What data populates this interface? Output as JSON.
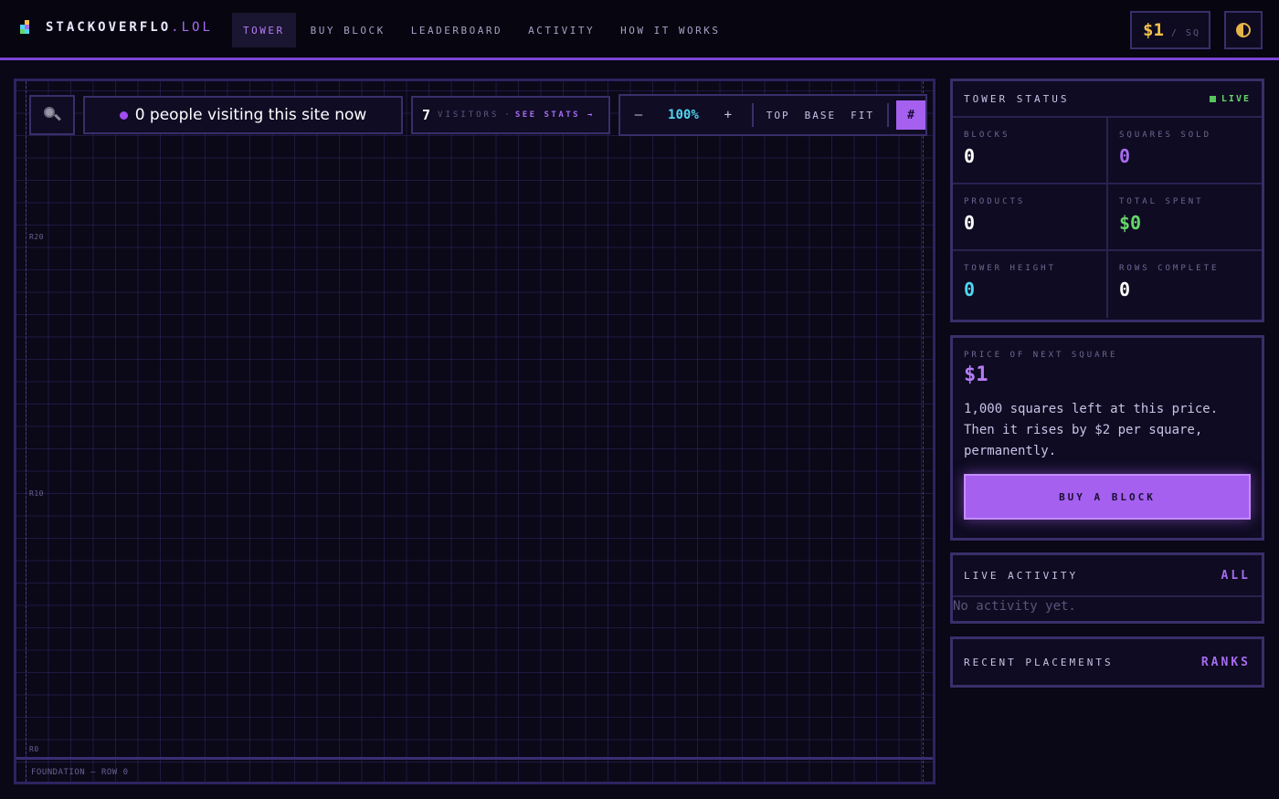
{
  "header": {
    "logo_main": "STACKOVERFLO",
    "logo_tld": ".LOL",
    "logo_colors": [
      "#f2c04a",
      "#4fd6f0",
      "#a66cf0",
      "#66d66a"
    ],
    "nav": [
      {
        "label": "TOWER",
        "active": true
      },
      {
        "label": "BUY BLOCK",
        "active": false
      },
      {
        "label": "LEADERBOARD",
        "active": false
      },
      {
        "label": "ACTIVITY",
        "active": false
      },
      {
        "label": "HOW IT WORKS",
        "active": false
      }
    ],
    "price": "$1",
    "price_unit": "/ SQ",
    "theme_icon": "half-circle-icon"
  },
  "tower": {
    "visiting_text": "0 people visiting this site now",
    "visitors_count": "7",
    "visitors_label": "VISITORS",
    "visitors_sep": "·",
    "see_stats": "SEE STATS →",
    "zoom_minus": "–",
    "zoom_level": "100%",
    "zoom_plus": "+",
    "top_label": "TOP",
    "base_label": "BASE",
    "fit_label": "FIT",
    "grid_label": "#",
    "row_labels": [
      "R20",
      "R10",
      "R0"
    ],
    "foundation_label": "FOUNDATION — ROW 0"
  },
  "status": {
    "title": "TOWER STATUS",
    "live": "LIVE",
    "stats": [
      {
        "label": "BLOCKS",
        "value": "0",
        "color": "#ffffff"
      },
      {
        "label": "SQUARES SOLD",
        "value": "0",
        "color": "#a66cf0"
      },
      {
        "label": "PRODUCTS",
        "value": "0",
        "color": "#ffffff"
      },
      {
        "label": "TOTAL SPENT",
        "value": "$0",
        "color": "#66d66a"
      },
      {
        "label": "TOWER HEIGHT",
        "value": "0",
        "color": "#4fd6f0"
      },
      {
        "label": "ROWS COMPLETE",
        "value": "0",
        "color": "#ffffff"
      }
    ]
  },
  "next_price": {
    "label": "PRICE OF NEXT SQUARE",
    "value": "$1",
    "description": "1,000 squares left at this price. Then it rises by $2 per square, permanently.",
    "button": "BUY A BLOCK"
  },
  "activity": {
    "title": "LIVE ACTIVITY",
    "link": "ALL",
    "empty": "No activity yet."
  },
  "recent": {
    "title": "RECENT PLACEMENTS",
    "link": "RANKS"
  },
  "colors": {
    "accent": "#a560f0",
    "bg": "#0a0717",
    "border": "#3a2e6a",
    "gold": "#f2c04a",
    "cyan": "#4fd6f0",
    "green": "#66d66a"
  }
}
